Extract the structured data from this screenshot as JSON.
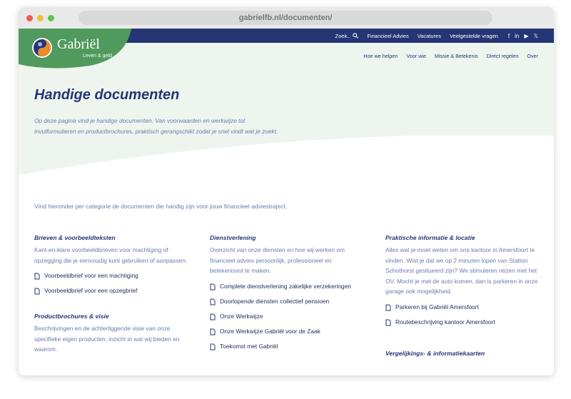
{
  "browser": {
    "url": "gabrielfb.nl/documenten/"
  },
  "brand": {
    "name": "Gabriël",
    "tagline": "Leven & geld",
    "green": "#4f9a5c",
    "navy": "#243676"
  },
  "topbar": {
    "search_label": "Zoek..",
    "links": [
      "Financieel Advies",
      "Vacatures",
      "Veelgestelde vragen"
    ],
    "social_icons": [
      "facebook-icon",
      "linkedin-icon",
      "youtube-icon",
      "x-icon"
    ]
  },
  "mainnav": [
    "Hoe we helpen",
    "Voor wie",
    "Missie & Betekenis",
    "Direct regelen",
    "Over"
  ],
  "hero": {
    "title": "Handige documenten",
    "intro": "Op deze pagina vind je handige documenten. Van voorwaarden en werkwijze tot invulformulieren en productbrochures, praktisch gerangschikt zodat je snel vindt wat je zoekt."
  },
  "lead": "Vind hieronder per categorie de documenten die handig zijn voor jouw financieel adviestraject.",
  "sections": {
    "brieven": {
      "title": "Brieven & voorbeeldteksten",
      "desc": "Kant-en-klare voorbeeldbrieven voor machtiging of opzegging die je eenvoudig kunt gebruiken of aanpassen.",
      "docs": [
        "Voorbeeldbrief voor een machtiging",
        "Voorbeeldbrief voor een opzegbrief"
      ]
    },
    "product": {
      "title": "Productbrochures & visie",
      "desc": "Beschrijvingen en de achterliggende visie van onze specifieke eigen producten; inzicht in wat wij bieden en waarom."
    },
    "dienst": {
      "title": "Dienstverlening",
      "desc": "Overzicht van onze diensten en hoe wij werken om financieel advies persoonlijk, professioneel en betekenisvol te maken.",
      "docs": [
        "Complete dienstverlening zakelijke verzekeringen",
        "Doorlopende diensten collectief pensioen",
        "Onze Werkwijze",
        "Onze Werkwijze Gabriël voor de Zaak",
        "Toekomst met Gabriël"
      ]
    },
    "praktisch": {
      "title": "Praktische informatie & locatie",
      "desc": "Alles wat je moet weten om ons kantoor in Amersfoort te vinden. Wist je dat we op 2 minuten lopen van Station Schothorst gesitueerd zijn? We stimuleren reizen met het OV. Mocht je met de auto komen, dan is parkeren in onze garage ook mogelijkheid.",
      "docs": [
        "Parkeren bij Gabriël Amersfoort",
        "Routebeschrijving kantoor Amersfoort"
      ]
    },
    "vergelijk": {
      "title": "Vergelijkings- & informatiekaarten"
    }
  }
}
